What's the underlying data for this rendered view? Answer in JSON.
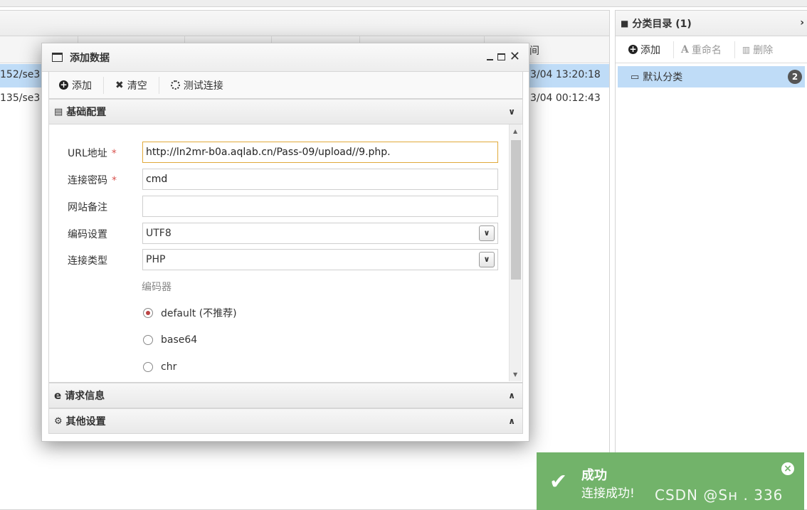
{
  "background": {
    "column_header_partial": "间",
    "rows": [
      {
        "url_partial": "152/se3",
        "time_partial": "3/04 13:20:18",
        "selected": true
      },
      {
        "url_partial": "135/se3",
        "time_partial": "3/04 00:12:43",
        "selected": false
      }
    ]
  },
  "sidebar": {
    "title": "分类目录 (1)",
    "tools": {
      "add": "添加",
      "rename": "重命名",
      "delete": "删除"
    },
    "category": {
      "name": "默认分类",
      "count": "2"
    }
  },
  "dialog": {
    "title": "添加数据",
    "toolbar": {
      "add": "添加",
      "clear": "清空",
      "test": "测试连接"
    },
    "section_basic": "基础配置",
    "section_request": "请求信息",
    "section_other": "其他设置",
    "fields": {
      "url_label": "URL地址",
      "url_value": "http://ln2mr-b0a.aqlab.cn/Pass-09/upload//9.php.",
      "password_label": "连接密码",
      "password_value": "cmd",
      "note_label": "网站备注",
      "note_value": "",
      "encoding_label": "编码设置",
      "encoding_value": "UTF8",
      "type_label": "连接类型",
      "type_value": "PHP",
      "required_mark": "*"
    },
    "encoder": {
      "label": "编码器",
      "options": [
        "default (不推荐)",
        "base64",
        "chr"
      ],
      "selected": "default (不推荐)"
    }
  },
  "toast": {
    "title": "成功",
    "message": "连接成功!",
    "color": "#72b36a"
  },
  "watermark": "CSDN @Sн    . 336"
}
